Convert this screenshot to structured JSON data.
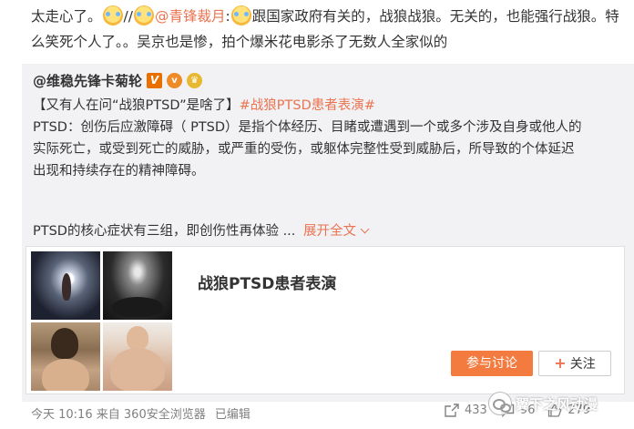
{
  "post": {
    "text_before": "太走心了。",
    "separator": "//",
    "mention": "@青锋裁月",
    "colon": ":",
    "text_after": "跟国家政府有关的，战狼战狼。无关的，也能强行战狼。特么笑死个人了。。吴京也是惨，拍个爆米花电影杀了无数人全家似的"
  },
  "repost": {
    "author": "@维稳先锋卡菊轮",
    "badge_v": "V",
    "badge_vip": "v",
    "badge_gold": "♛",
    "intro": "【又有人在问“战狼PTSD”是啥了】",
    "hashtag": "#战狼PTSD患者表演#",
    "line1": "PTSD：创伤后应激障碍（ PTSD）是指个体经历、目睹或遭遇到一个或多个涉及自身或他人的",
    "line2": "实际死亡，或受到死亡的威胁，或严重的受伤，或躯体完整性受到威胁后，所导致的个体延迟",
    "line3": "出现和持续存在的精神障碍。",
    "summary": "PTSD的核心症状有三组，即创伤性再体验 ...",
    "expand_label": "展开全文"
  },
  "card": {
    "title": "战狼PTSD患者表演",
    "discuss_label": "参与讨论",
    "follow_label": "关注"
  },
  "meta": {
    "time": "今天 10:16",
    "source_prefix": "来自",
    "source": "360安全浏览器",
    "edited": "已编辑"
  },
  "actions": {
    "repost_count": "433",
    "comment_count": "96",
    "like_count": "279"
  },
  "watermark": {
    "text": "翼下之风动漫"
  },
  "colors": {
    "accent": "#eb7350",
    "button_orange": "#f37b3f",
    "repost_bg": "#f2f2f5"
  }
}
